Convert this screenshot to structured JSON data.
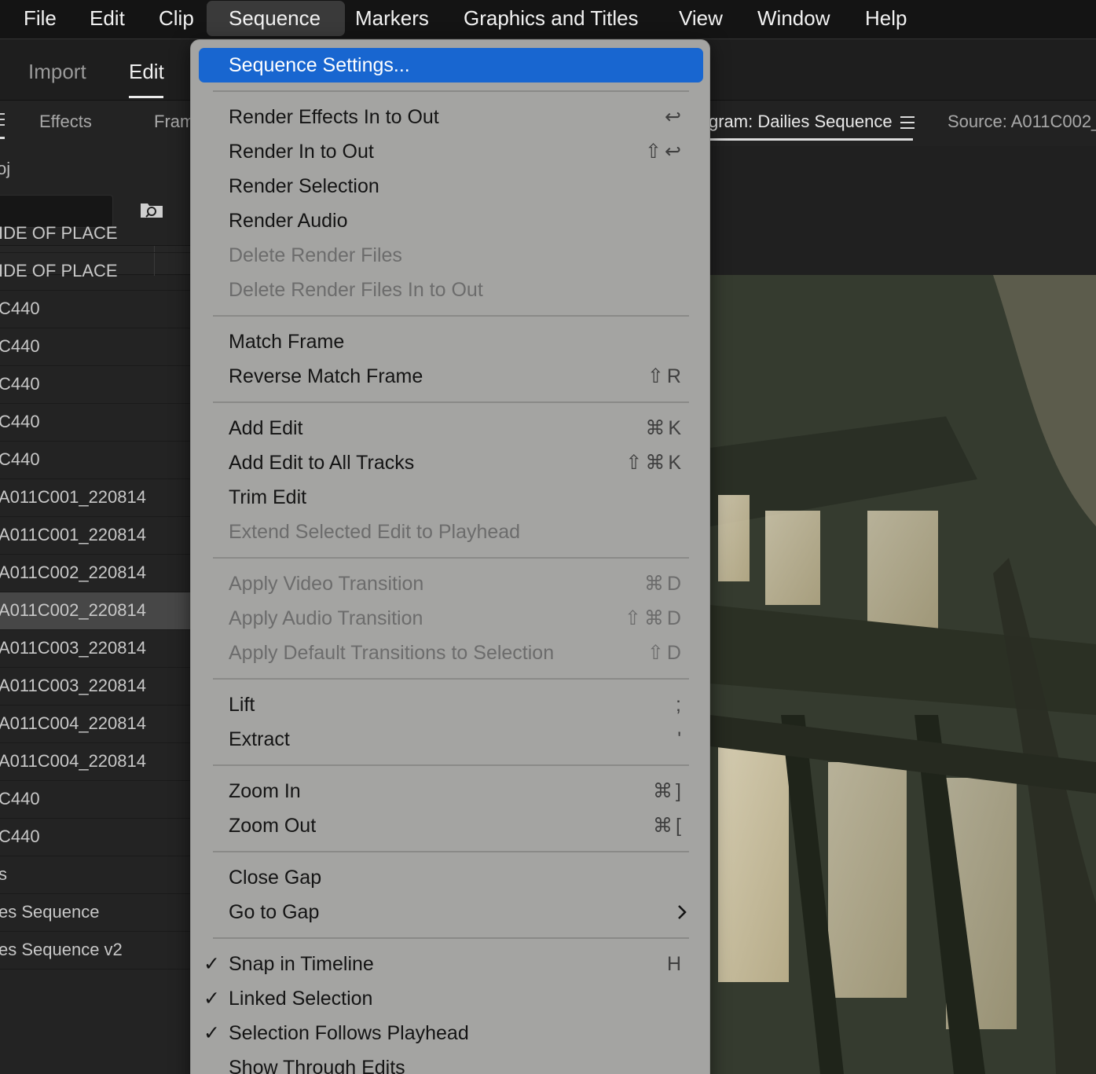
{
  "menubar": {
    "items": [
      "File",
      "Edit",
      "Clip",
      "Sequence",
      "Markers",
      "Graphics and Titles",
      "View",
      "Window",
      "Help"
    ],
    "active": "Sequence"
  },
  "workspace": {
    "tabs": [
      "Import",
      "Edit"
    ],
    "active": "Edit"
  },
  "project_panel": {
    "tabs": [
      "Effects",
      "Fram"
    ],
    "project_label": "oj",
    "rows": [
      "IDE OF PLACE",
      "IDE OF PLACE",
      "C440",
      "C440",
      "C440",
      "C440",
      "C440",
      "A011C001_220814",
      "A011C001_220814",
      "A011C002_220814",
      "A011C002_220814",
      "A011C003_220814",
      "A011C003_220814",
      "A011C004_220814",
      "A011C004_220814",
      "C440",
      "C440",
      "s",
      "es Sequence",
      "es Sequence v2"
    ],
    "selected_index": 10
  },
  "monitor": {
    "program_tab": "gram: Dailies Sequence",
    "source_tab": "Source: A011C002_"
  },
  "sequence_menu": {
    "items": [
      {
        "label": "Sequence Settings...",
        "shortcut": "",
        "disabled": false,
        "highlight": true
      },
      {
        "label": "Render Effects In to Out",
        "shortcut": "↩",
        "disabled": false
      },
      {
        "label": "Render In to Out",
        "shortcut": "⇧↩",
        "disabled": false
      },
      {
        "label": "Render Selection",
        "shortcut": "",
        "disabled": false
      },
      {
        "label": "Render Audio",
        "shortcut": "",
        "disabled": false
      },
      {
        "label": "Delete Render Files",
        "shortcut": "",
        "disabled": true
      },
      {
        "label": "Delete Render Files In to Out",
        "shortcut": "",
        "disabled": true
      },
      {
        "label": "Match Frame",
        "shortcut": "",
        "disabled": false
      },
      {
        "label": "Reverse Match Frame",
        "shortcut": "⇧R",
        "disabled": false
      },
      {
        "label": "Add Edit",
        "shortcut": "⌘K",
        "disabled": false
      },
      {
        "label": "Add Edit to All Tracks",
        "shortcut": "⇧⌘K",
        "disabled": false
      },
      {
        "label": "Trim Edit",
        "shortcut": "",
        "disabled": false
      },
      {
        "label": "Extend Selected Edit to Playhead",
        "shortcut": "",
        "disabled": true
      },
      {
        "label": "Apply Video Transition",
        "shortcut": "⌘D",
        "disabled": true
      },
      {
        "label": "Apply Audio Transition",
        "shortcut": "⇧⌘D",
        "disabled": true
      },
      {
        "label": "Apply Default Transitions to Selection",
        "shortcut": "⇧D",
        "disabled": true
      },
      {
        "label": "Lift",
        "shortcut": ";",
        "disabled": false
      },
      {
        "label": "Extract",
        "shortcut": "'",
        "disabled": false
      },
      {
        "label": "Zoom In",
        "shortcut": "⌘]",
        "disabled": false
      },
      {
        "label": "Zoom Out",
        "shortcut": "⌘[",
        "disabled": false
      },
      {
        "label": "Close Gap",
        "shortcut": "",
        "disabled": false
      },
      {
        "label": "Go to Gap",
        "shortcut": "",
        "disabled": false,
        "submenu": true
      },
      {
        "label": "Snap in Timeline",
        "shortcut": "H",
        "disabled": false,
        "checked": true
      },
      {
        "label": "Linked Selection",
        "shortcut": "",
        "disabled": false,
        "checked": true
      },
      {
        "label": "Selection Follows Playhead",
        "shortcut": "",
        "disabled": false,
        "checked": true
      },
      {
        "label": "Show Through Edits",
        "shortcut": "",
        "disabled": false
      }
    ],
    "check_glyph": "✓"
  }
}
